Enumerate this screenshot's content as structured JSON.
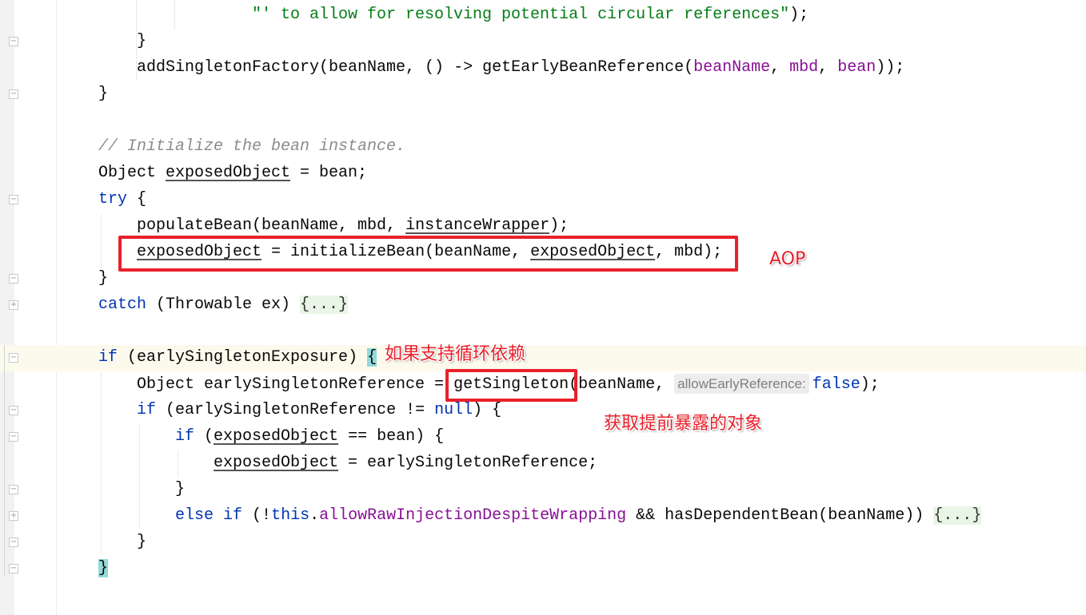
{
  "editor": {
    "lines": [
      {
        "indent": 16,
        "tokens": [
          [
            "\"' to allow for resolving potential circular references\"",
            "str"
          ],
          [
            ");",
            "plain"
          ]
        ]
      },
      {
        "indent": 4,
        "tokens": [
          [
            "}",
            "plain"
          ]
        ]
      },
      {
        "indent": 4,
        "tokens": [
          [
            "addSingletonFactory(beanName, () -> getEarlyBeanReference(",
            "plain"
          ],
          [
            "beanName",
            "field"
          ],
          [
            ", ",
            "plain"
          ],
          [
            "mbd",
            "field"
          ],
          [
            ", ",
            "plain"
          ],
          [
            "bean",
            "field"
          ],
          [
            "));",
            "plain"
          ]
        ]
      },
      {
        "indent": 0,
        "tokens": [
          [
            "}",
            "plain"
          ]
        ]
      },
      {
        "indent": 0,
        "tokens": []
      },
      {
        "indent": 0,
        "tokens": [
          [
            "// Initialize the bean instance.",
            "cmt"
          ]
        ]
      },
      {
        "indent": 0,
        "tokens": [
          [
            "Object ",
            "plain"
          ],
          [
            "exposedObject",
            "under"
          ],
          [
            " = bean;",
            "plain"
          ]
        ]
      },
      {
        "indent": 0,
        "tokens": [
          [
            "try",
            "kw"
          ],
          [
            " {",
            "plain"
          ]
        ]
      },
      {
        "indent": 4,
        "tokens": [
          [
            "populateBean(beanName, mbd, ",
            "plain"
          ],
          [
            "instanceWrapper",
            "under"
          ],
          [
            ");",
            "plain"
          ]
        ]
      },
      {
        "indent": 4,
        "tokens": [
          [
            "exposedObject",
            "under"
          ],
          [
            " = initializeBean(beanName, ",
            "plain"
          ],
          [
            "exposedObject",
            "under"
          ],
          [
            ", mbd);",
            "plain"
          ]
        ]
      },
      {
        "indent": 0,
        "tokens": [
          [
            "}",
            "plain"
          ]
        ]
      },
      {
        "indent": 0,
        "tokens": [
          [
            "catch",
            "kw"
          ],
          [
            " (Throwable ex) ",
            "plain"
          ],
          [
            "{...}",
            "fold-txt"
          ]
        ]
      },
      {
        "indent": 0,
        "tokens": []
      },
      {
        "indent": 0,
        "tokens": [
          [
            "if",
            "kw"
          ],
          [
            " (earlySingletonExposure) ",
            "plain"
          ],
          [
            "{",
            "brace"
          ]
        ]
      },
      {
        "indent": 4,
        "tokens": [
          [
            "Object earlySingletonReference = getSingleton(beanName, ",
            "plain"
          ],
          [
            "allowEarlyReference:",
            "hint"
          ],
          [
            "false",
            "kw"
          ],
          [
            ");",
            "plain"
          ]
        ]
      },
      {
        "indent": 4,
        "tokens": [
          [
            "if",
            "kw"
          ],
          [
            " (earlySingletonReference != ",
            "plain"
          ],
          [
            "null",
            "kw"
          ],
          [
            ") {",
            "plain"
          ]
        ]
      },
      {
        "indent": 8,
        "tokens": [
          [
            "if",
            "kw"
          ],
          [
            " (",
            "plain"
          ],
          [
            "exposedObject",
            "under"
          ],
          [
            " == bean) {",
            "plain"
          ]
        ]
      },
      {
        "indent": 12,
        "tokens": [
          [
            "exposedObject",
            "under"
          ],
          [
            " = earlySingletonReference;",
            "plain"
          ]
        ]
      },
      {
        "indent": 8,
        "tokens": [
          [
            "}",
            "plain"
          ]
        ]
      },
      {
        "indent": 8,
        "tokens": [
          [
            "else",
            "kw"
          ],
          [
            " ",
            "plain"
          ],
          [
            "if",
            "kw"
          ],
          [
            " (!",
            "plain"
          ],
          [
            "this",
            "kw"
          ],
          [
            ".",
            "plain"
          ],
          [
            "allowRawInjectionDespiteWrapping",
            "field"
          ],
          [
            " && hasDependentBean(beanName)) ",
            "plain"
          ],
          [
            "{...}",
            "fold-txt"
          ]
        ]
      },
      {
        "indent": 4,
        "tokens": [
          [
            "}",
            "plain"
          ]
        ]
      },
      {
        "indent": 0,
        "tokens": [
          [
            "}",
            "brace"
          ]
        ]
      }
    ]
  },
  "annotations": {
    "aop": "AOP",
    "circular_support": "如果支持循环依赖",
    "get_early_exposed": "获取提前暴露的对象"
  },
  "colors": {
    "annotation_red": "#e8202a",
    "keyword": "#0033b3",
    "field": "#871094",
    "string": "#067d17"
  }
}
